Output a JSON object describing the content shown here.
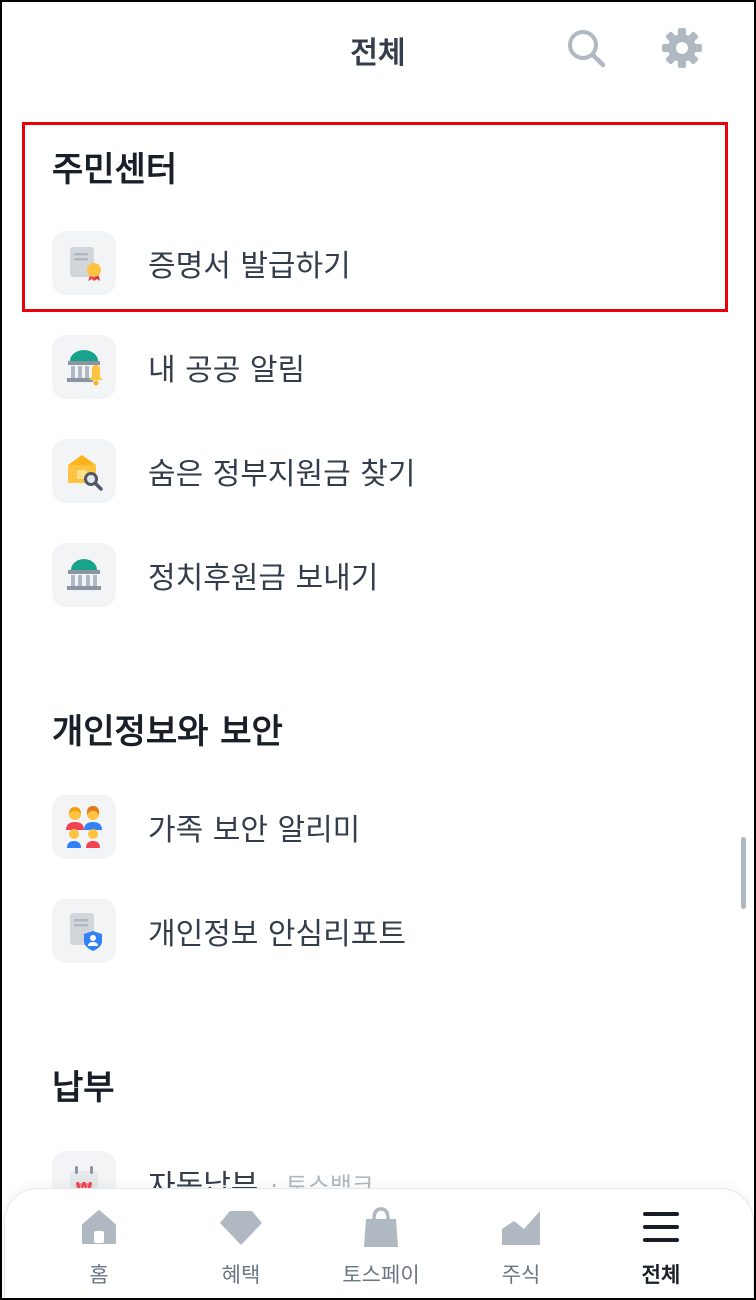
{
  "header": {
    "title": "전체",
    "search_icon": "search-icon",
    "settings_icon": "gear-icon"
  },
  "sections": [
    {
      "title": "주민센터",
      "items": [
        {
          "label": "증명서 발급하기",
          "icon": "certificate-icon"
        },
        {
          "label": "내 공공 알림",
          "icon": "government-bell-icon"
        },
        {
          "label": "숨은 정부지원금 찾기",
          "icon": "building-search-icon"
        },
        {
          "label": "정치후원금 보내기",
          "icon": "government-building-icon"
        }
      ]
    },
    {
      "title": "개인정보와 보안",
      "items": [
        {
          "label": "가족 보안 알리미",
          "icon": "family-icon"
        },
        {
          "label": "개인정보 안심리포트",
          "icon": "privacy-report-icon"
        }
      ]
    },
    {
      "title": "납부",
      "items": [
        {
          "label": "자동납부",
          "sub": "· 토스뱅크",
          "icon": "won-calendar-icon"
        }
      ]
    }
  ],
  "bottom_nav": [
    {
      "label": "홈",
      "icon": "home-icon"
    },
    {
      "label": "혜택",
      "icon": "diamond-icon"
    },
    {
      "label": "토스페이",
      "icon": "shopping-bag-icon"
    },
    {
      "label": "주식",
      "icon": "stock-chart-icon"
    },
    {
      "label": "전체",
      "icon": "menu-icon",
      "active": true
    }
  ],
  "colors": {
    "highlight_border": "#e8000b",
    "text_primary": "#191f28",
    "text_secondary": "#333d4b",
    "nav_inactive": "#6b7684",
    "icon_gray": "#b0b8c1"
  }
}
